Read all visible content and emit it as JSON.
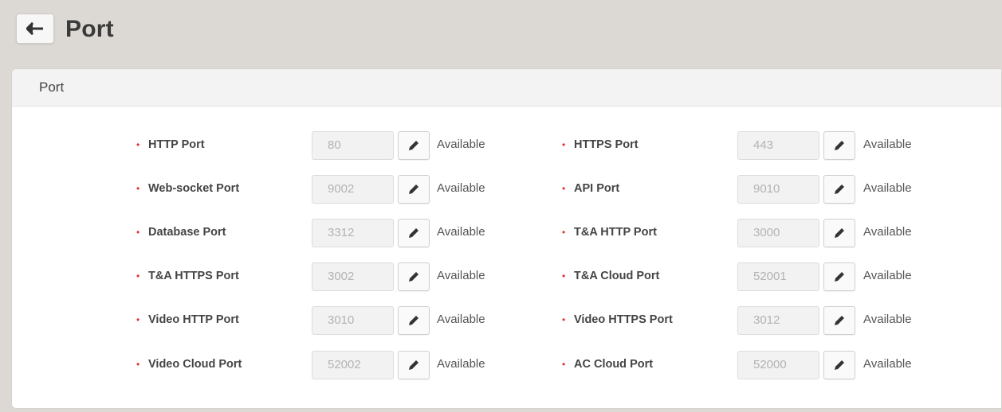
{
  "header": {
    "title": "Port",
    "back_icon": "arrow-left-icon"
  },
  "panel": {
    "title": "Port"
  },
  "fields": {
    "http": {
      "label": "HTTP Port",
      "value": "80",
      "status": "Available"
    },
    "https": {
      "label": "HTTPS Port",
      "value": "443",
      "status": "Available"
    },
    "websocket": {
      "label": "Web-socket Port",
      "value": "9002",
      "status": "Available"
    },
    "api": {
      "label": "API Port",
      "value": "9010",
      "status": "Available"
    },
    "database": {
      "label": "Database Port",
      "value": "3312",
      "status": "Available"
    },
    "ta_http": {
      "label": "T&A HTTP Port",
      "value": "3000",
      "status": "Available"
    },
    "ta_https": {
      "label": "T&A HTTPS Port",
      "value": "3002",
      "status": "Available"
    },
    "ta_cloud": {
      "label": "T&A Cloud Port",
      "value": "52001",
      "status": "Available"
    },
    "video_http": {
      "label": "Video HTTP Port",
      "value": "3010",
      "status": "Available"
    },
    "video_https": {
      "label": "Video HTTPS Port",
      "value": "3012",
      "status": "Available"
    },
    "video_cloud": {
      "label": "Video Cloud Port",
      "value": "52002",
      "status": "Available"
    },
    "ac_cloud": {
      "label": "AC Cloud Port",
      "value": "52000",
      "status": "Available"
    }
  },
  "required_marker": "•",
  "edit_icon": "pencil-icon",
  "colors": {
    "background": "#dcd8d3",
    "required_marker": "#e0302c",
    "input_text": "#b3b3b3"
  }
}
